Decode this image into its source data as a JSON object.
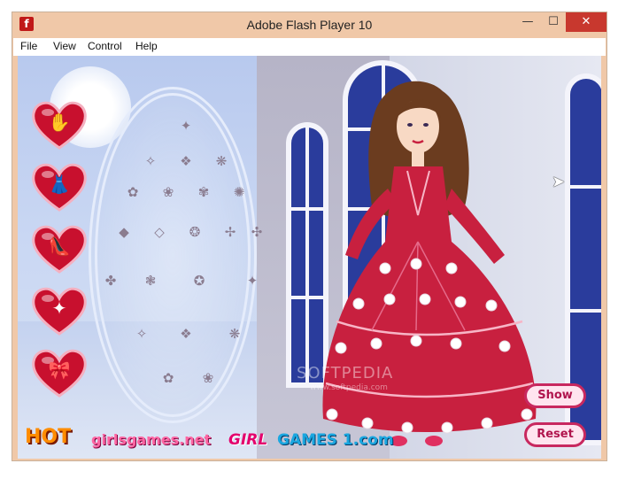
{
  "window": {
    "title": "Adobe Flash Player 10",
    "icon": "flash-icon",
    "controls": {
      "minimize": "—",
      "maximize": "☐",
      "close": "✕"
    }
  },
  "menu": [
    "File",
    "View",
    "Control",
    "Help"
  ],
  "game": {
    "category_hearts": [
      {
        "name": "gloves",
        "glyph": "✋"
      },
      {
        "name": "dresses",
        "glyph": "👗"
      },
      {
        "name": "shoes",
        "glyph": "👠"
      },
      {
        "name": "wands",
        "glyph": "✦"
      },
      {
        "name": "bags",
        "glyph": "🎀"
      }
    ],
    "buttons": {
      "show": "Show",
      "reset": "Reset"
    },
    "logos": {
      "hot": "HOT",
      "girlsgames": "girlsgames.net",
      "girl": "GIRL",
      "games1": "GAMES 1.com"
    },
    "watermark": {
      "main": "SOFTPEDIA",
      "sub": "www.softpedia.com"
    },
    "colors": {
      "dress": "#d0274f",
      "heart": "#c8102e",
      "window_frame": "#2a3c9c",
      "pill_border": "#c8285f"
    },
    "accessory_icons": [
      "✦",
      "✧",
      "❖",
      "❋",
      "✿",
      "❀",
      "✾",
      "✺",
      "◆",
      "◇",
      "❂",
      "✢",
      "✣",
      "✤",
      "❃",
      "✪"
    ]
  }
}
